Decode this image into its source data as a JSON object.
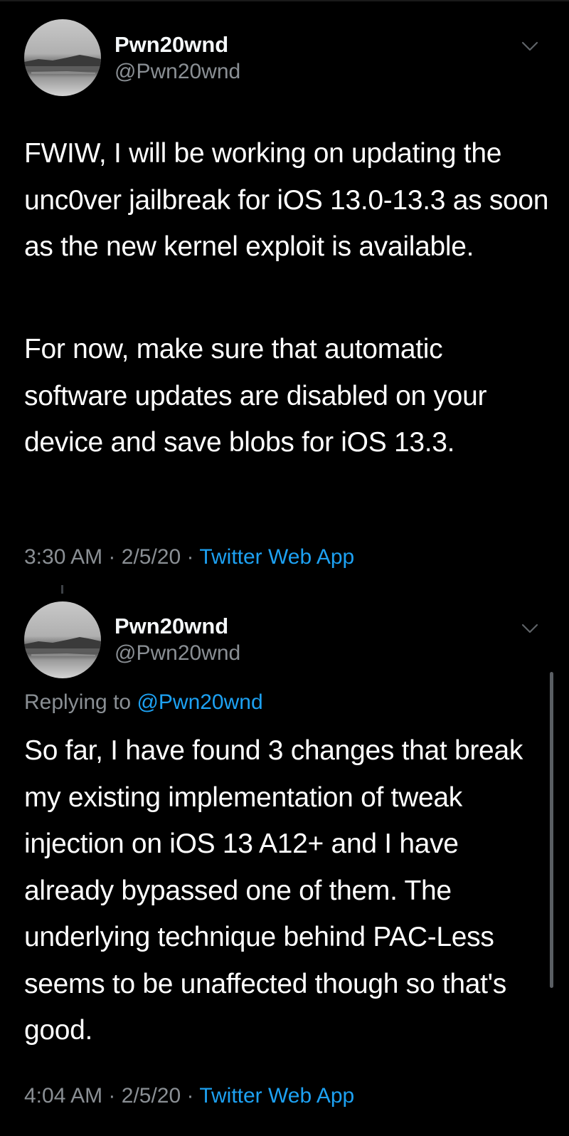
{
  "colors": {
    "background": "#000000",
    "text": "#ffffff",
    "secondary": "#8a8f94",
    "link": "#1da1f2"
  },
  "tweets": [
    {
      "author": {
        "name": "Pwn20wnd",
        "handle": "@Pwn20wnd"
      },
      "paragraphs": [
        "FWIW, I will be working on updating the unc0ver jailbreak for iOS 13.0-13.3 as soon as the new kernel exploit is available.",
        "For now, make sure that automatic software updates are disabled on your device and save blobs for iOS 13.3."
      ],
      "time": "3:30 AM",
      "date": "2/5/20",
      "separator": "·",
      "source": "Twitter Web App",
      "menu_icon": "chevron-down-icon"
    },
    {
      "author": {
        "name": "Pwn20wnd",
        "handle": "@Pwn20wnd"
      },
      "replying_to_label": "Replying to",
      "replying_to_handle": "@Pwn20wnd",
      "paragraphs": [
        "So far, I have found 3 changes that break my existing implementation of tweak injection on iOS 13 A12+ and I have already bypassed one of them. The underlying technique behind PAC-Less seems to be unaffected though so that's good."
      ],
      "time": "4:04 AM",
      "date": "2/5/20",
      "separator": "·",
      "source": "Twitter Web App",
      "menu_icon": "chevron-down-icon"
    }
  ]
}
